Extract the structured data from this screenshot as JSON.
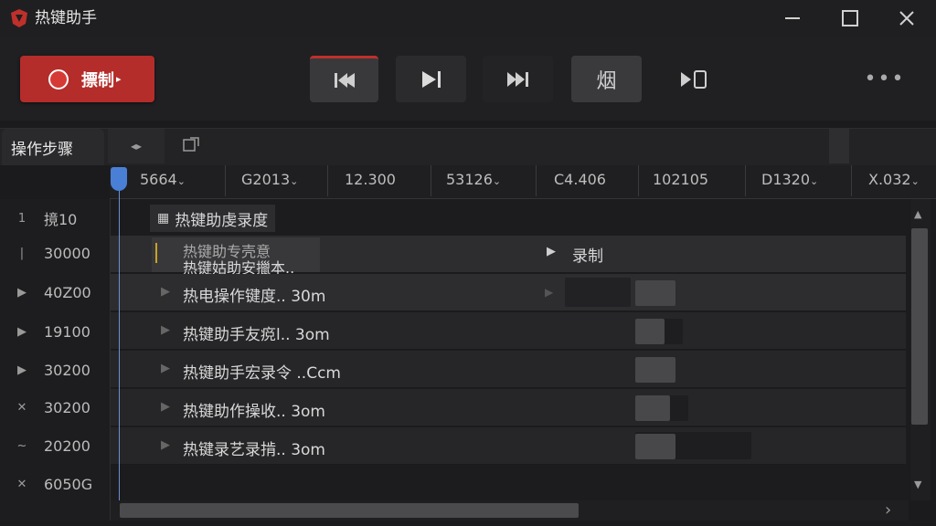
{
  "window": {
    "title": "热键助手",
    "logo_icon": "app-logo-icon",
    "controls": [
      "minimize-icon",
      "maximize-icon",
      "close-icon"
    ]
  },
  "toolbar": {
    "record_label": "摽制",
    "buttons": [
      {
        "name": "rewind-button",
        "icon": "rewind-icon"
      },
      {
        "name": "step-forward-button",
        "icon": "step-forward-icon"
      },
      {
        "name": "fast-forward-button",
        "icon": "fast-forward-icon"
      },
      {
        "name": "format-button",
        "label": "烟"
      },
      {
        "name": "play-to-end-button",
        "icon": "play-to-end-icon"
      },
      {
        "name": "more-button",
        "icon": "more-icon"
      }
    ],
    "accent_color": "#b42d2a"
  },
  "tabs": {
    "active": "操作步骤",
    "extra_icons": [
      "collapse-icon",
      "popout-icon"
    ]
  },
  "ruler": [
    "5664",
    "G2013",
    "12.300",
    "53126",
    "C4.406",
    "102105",
    "D1320",
    "X.032"
  ],
  "left_rows": [
    {
      "icon": "1",
      "value": "摬10"
    },
    {
      "icon": "|",
      "value": "30000"
    },
    {
      "icon": "▶",
      "value": "40Z00"
    },
    {
      "icon": "▶",
      "value": "19100"
    },
    {
      "icon": "▶",
      "value": "30200"
    },
    {
      "icon": "✕",
      "value": "30200"
    },
    {
      "icon": "~",
      "value": "20200"
    },
    {
      "icon": "✕",
      "value": "6050G"
    }
  ],
  "rows": {
    "header": "热键助虔录度",
    "r1_a": "热键助专壳意",
    "r1_b": "热键姑助安擸本..",
    "r1_record": "录制",
    "r2": "热电操作键度.. 30m",
    "r3": "热键助手友痥l.. 3om",
    "r4": "热键助手宏录令 ..Ccm",
    "r5": "热键助作操收.. 3om",
    "r6": "热键录艺录掯.. 3om"
  }
}
